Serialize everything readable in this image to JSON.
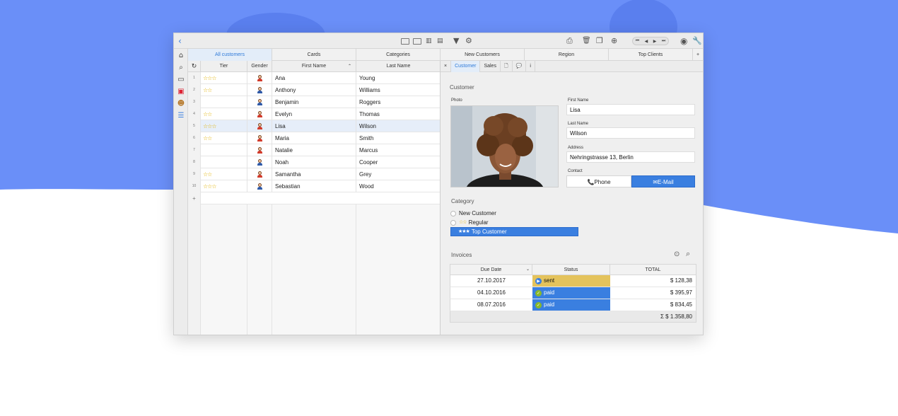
{
  "colors": {
    "background_blue": "#6a8ff8",
    "accent": "#3a7fe0",
    "star": "#e2b200",
    "sent": "#e4c35c",
    "paid": "#3a7fe0"
  },
  "toolbar": {
    "icons": [
      "back-icon",
      "table-view-icon",
      "grid-view-icon",
      "chart-icon",
      "db-icon",
      "filter-icon",
      "gear-icon",
      "print-icon",
      "trash-icon",
      "copy-icon",
      "add-icon",
      "first-icon",
      "prev-icon",
      "next-icon",
      "last-icon",
      "user-icon",
      "wrench-icon"
    ]
  },
  "sidebar": {
    "icons": [
      "home-icon",
      "search-icon",
      "calendar-icon",
      "gift-icon",
      "people-icon",
      "layers-icon"
    ]
  },
  "tabs": [
    "All customers",
    "Cards",
    "Categories",
    "New Customers",
    "Region",
    "Top Clients",
    "+"
  ],
  "grid": {
    "headers": {
      "tier": "Tier",
      "gender": "Gender",
      "first_name": "First Name",
      "last_name": "Last Name"
    },
    "add_row": "+",
    "rows": [
      {
        "n": "1",
        "stars": "☆☆☆",
        "gender": "f",
        "first": "Ana",
        "last": "Young"
      },
      {
        "n": "2",
        "stars": "☆☆",
        "gender": "m",
        "first": "Anthony",
        "last": "Williams"
      },
      {
        "n": "3",
        "stars": "",
        "gender": "m",
        "first": "Benjamin",
        "last": "Roggers"
      },
      {
        "n": "4",
        "stars": "☆☆",
        "gender": "f",
        "first": "Evelyn",
        "last": "Thomas"
      },
      {
        "n": "5",
        "stars": "☆☆☆",
        "gender": "f",
        "first": "Lisa",
        "last": "Wilson"
      },
      {
        "n": "6",
        "stars": "☆☆",
        "gender": "f",
        "first": "Maria",
        "last": "Smith"
      },
      {
        "n": "7",
        "stars": "",
        "gender": "f",
        "first": "Natalie",
        "last": "Marcus"
      },
      {
        "n": "8",
        "stars": "",
        "gender": "m",
        "first": "Noah",
        "last": "Cooper"
      },
      {
        "n": "9",
        "stars": "☆☆",
        "gender": "f",
        "first": "Samantha",
        "last": "Grey"
      },
      {
        "n": "10",
        "stars": "☆☆☆",
        "gender": "m",
        "first": "Sebastian",
        "last": "Wood"
      }
    ]
  },
  "subtabs": [
    "×",
    "Customer",
    "Sales",
    "🗋",
    "💬",
    "i"
  ],
  "detail": {
    "section": "Customer",
    "photo_label": "Photo",
    "first_name_label": "First Name",
    "first_name": "Lisa",
    "last_name_label": "Last Name",
    "last_name": "Wilson",
    "address_label": "Address",
    "address": "Nehringstrasse 13, Berlin",
    "contact_label": "Contact",
    "phone": "Phone",
    "email": "E-Mail",
    "category_title": "Category",
    "categories": [
      {
        "stars": "",
        "label": "New Customer"
      },
      {
        "stars": "☆☆",
        "label": "Regular"
      },
      {
        "stars": "★★★",
        "label": "Top Customer"
      }
    ],
    "invoices_title": "Invoices",
    "invoice_headers": {
      "due": "Due Date",
      "status": "Status",
      "total": "TOTAL"
    },
    "invoices": [
      {
        "due": "27.10.2017",
        "status": "sent",
        "total": "$ 128,38"
      },
      {
        "due": "04.10.2016",
        "status": "paid",
        "total": "$ 395,97"
      },
      {
        "due": "08.07.2016",
        "status": "paid",
        "total": "$ 834,45"
      }
    ],
    "sum": "Σ $ 1.358,80"
  }
}
